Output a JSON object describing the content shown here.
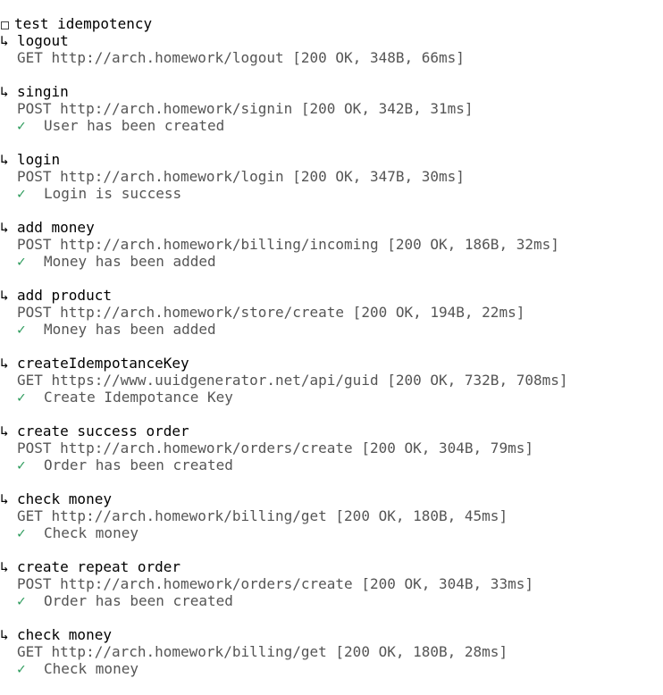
{
  "suite": {
    "title": "test idempotency",
    "icon": "checkbox-icon"
  },
  "requests": [
    {
      "name": "logout",
      "request": "GET http://arch.homework/logout [200 OK, 348B, 66ms]",
      "assertion": ""
    },
    {
      "name": "singin",
      "request": "POST http://arch.homework/signin [200 OK, 342B, 31ms]",
      "assertion": "User has been created"
    },
    {
      "name": "login",
      "request": "POST http://arch.homework/login [200 OK, 347B, 30ms]",
      "assertion": "Login is success"
    },
    {
      "name": "add money",
      "request": "POST http://arch.homework/billing/incoming [200 OK, 186B, 32ms]",
      "assertion": "Money has been added"
    },
    {
      "name": "add product",
      "request": "POST http://arch.homework/store/create [200 OK, 194B, 22ms]",
      "assertion": "Money has been added"
    },
    {
      "name": "createIdempotanceKey",
      "request": "GET https://www.uuidgenerator.net/api/guid [200 OK, 732B, 708ms]",
      "assertion": "Create Idempotance Key"
    },
    {
      "name": "create success order",
      "request": "POST http://arch.homework/orders/create [200 OK, 304B, 79ms]",
      "assertion": "Order has been created"
    },
    {
      "name": "check money",
      "request": "GET http://arch.homework/billing/get [200 OK, 180B, 45ms]",
      "assertion": "Check money"
    },
    {
      "name": "create repeat order",
      "request": "POST http://arch.homework/orders/create [200 OK, 304B, 33ms]",
      "assertion": "Order has been created"
    },
    {
      "name": "check money",
      "request": "GET http://arch.homework/billing/get [200 OK, 180B, 28ms]",
      "assertion": "Check money"
    }
  ],
  "glyphs": {
    "arrow": "↳",
    "tick": "✓"
  },
  "colors": {
    "text": "#000000",
    "request": "#555555",
    "tick": "#2a9a5a"
  }
}
